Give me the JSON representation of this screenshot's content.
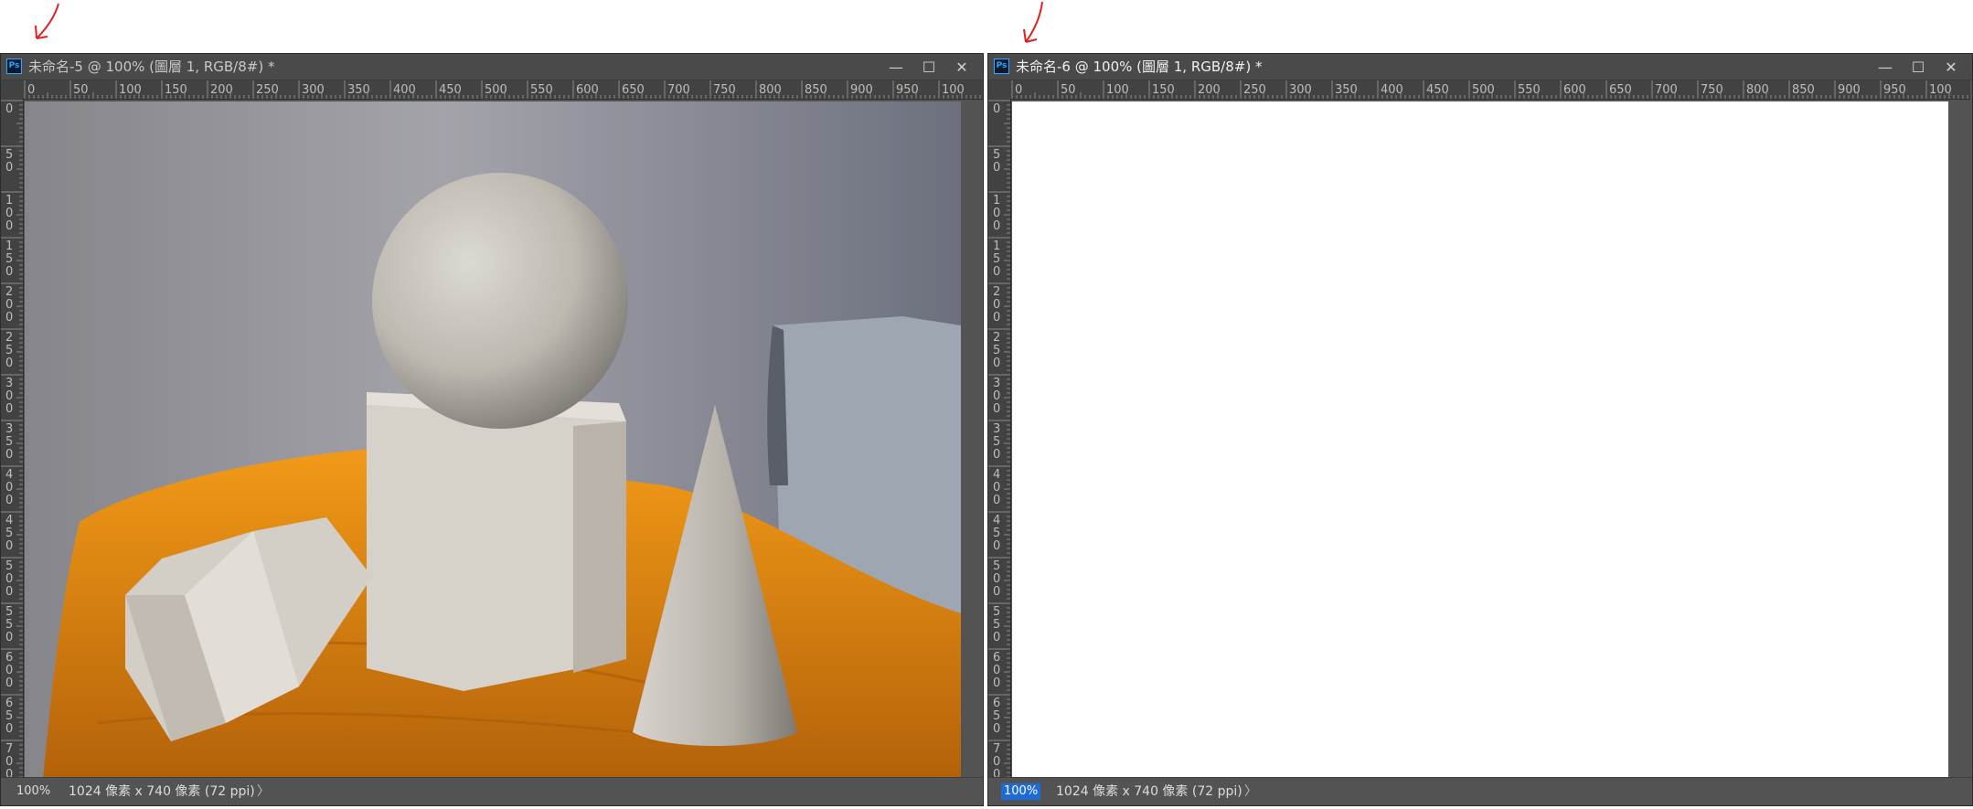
{
  "windows": [
    {
      "title": "未命名-5 @ 100% (圖層 1, RGB/8#) *",
      "active": false,
      "zoom": "100%",
      "doc_info": "1024 像素 x 740 像素 (72 ppi)",
      "content": "photo"
    },
    {
      "title": "未命名-6 @ 100% (圖層 1, RGB/8#) *",
      "active": true,
      "zoom": "100%",
      "doc_info": "1024 像素 x 740 像素 (72 ppi)",
      "content": "blank"
    }
  ],
  "ps_icon": "Ps",
  "window_buttons": {
    "minimize": "—",
    "maximize": "☐",
    "close": "✕"
  },
  "status_arrow": "〉",
  "ruler_h_labels": [
    "0",
    "50",
    "100",
    "150",
    "200",
    "250",
    "300",
    "350",
    "400",
    "450",
    "500",
    "550",
    "600",
    "650",
    "700",
    "750",
    "800",
    "850",
    "900",
    "950",
    "100"
  ],
  "ruler_v_labels": [
    "0",
    "50",
    "100",
    "150",
    "200",
    "250",
    "300",
    "350",
    "400",
    "450",
    "500",
    "550",
    "600",
    "650",
    "700"
  ],
  "colors": {
    "annotation": "#e02020",
    "cloth": "#e88a10",
    "selection": "#1c6bd6"
  }
}
